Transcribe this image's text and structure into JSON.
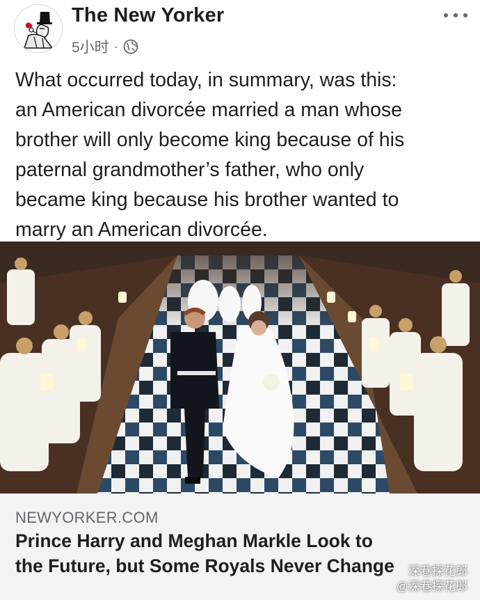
{
  "post": {
    "page_name": "The New Yorker",
    "timestamp": "5小时",
    "separator": "·",
    "privacy_icon": "globe-icon",
    "more_icon": "more-dots-icon",
    "text_lines": [
      "What occurred today, in summary, was this:",
      "an American divorcée married a man whose",
      "brother will only become king because of his",
      "paternal grandmother’s father, who only",
      "became king because his brother wanted to",
      "marry an American divorcée."
    ]
  },
  "link_preview": {
    "domain": "NEWYORKER.COM",
    "headline_lines": [
      "Prince Harry and Meghan Markle Look to",
      "the Future, but Some Royals Never Change"
    ]
  },
  "watermark": {
    "line1": "深巷探花郎",
    "line2": "@深巷探花郎"
  },
  "colors": {
    "text": "#1c1e21",
    "secondary": "#606770",
    "card_bg": "#f2f3f5"
  }
}
